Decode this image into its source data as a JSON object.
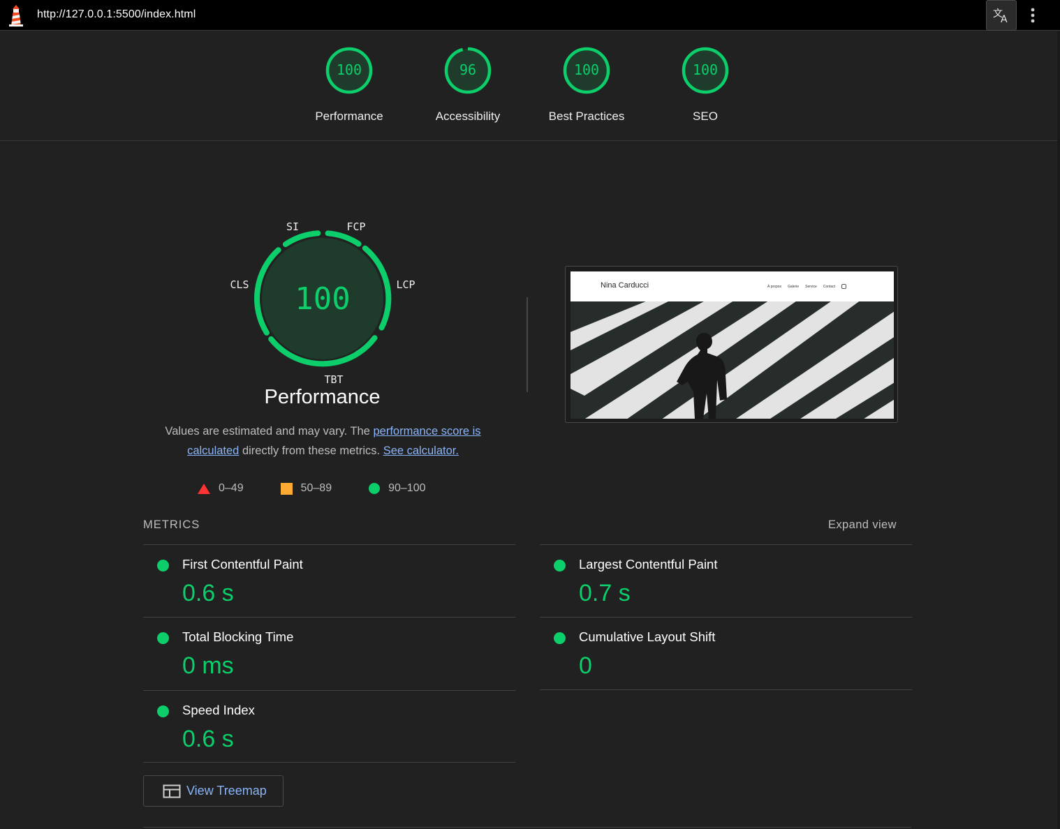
{
  "topbar": {
    "url": "http://127.0.0.1:5500/index.html"
  },
  "colors": {
    "pass": "#0cce6b",
    "average": "#ffaa33",
    "fail": "#ff3333",
    "link": "#8ab4f8"
  },
  "categories": [
    {
      "label": "Performance",
      "score": "100",
      "fraction": 1.0
    },
    {
      "label": "Accessibility",
      "score": "96",
      "fraction": 0.96
    },
    {
      "label": "Best Practices",
      "score": "100",
      "fraction": 1.0
    },
    {
      "label": "SEO",
      "score": "100",
      "fraction": 1.0
    }
  ],
  "performance": {
    "score": "100",
    "title": "Performance",
    "segment_labels": {
      "si": "SI",
      "fcp": "FCP",
      "cls": "CLS",
      "lcp": "LCP",
      "tbt": "TBT"
    }
  },
  "description": {
    "text1": "Values are estimated and may vary. The ",
    "link1": "performance score is calculated",
    "text2": " directly from these metrics. ",
    "link2": "See calculator."
  },
  "legend": {
    "fail": "0–49",
    "average": "50–89",
    "pass": "90–100"
  },
  "screenshot": {
    "site_name": "Nina Carducci",
    "nav": [
      "À propos",
      "Galerie",
      "Service",
      "Contact"
    ]
  },
  "metrics": {
    "title": "METRICS",
    "expand_label": "Expand view",
    "items": [
      {
        "name": "First Contentful Paint",
        "value": "0.6 s"
      },
      {
        "name": "Largest Contentful Paint",
        "value": "0.7 s"
      },
      {
        "name": "Total Blocking Time",
        "value": "0 ms"
      },
      {
        "name": "Cumulative Layout Shift",
        "value": "0"
      },
      {
        "name": "Speed Index",
        "value": "0.6 s"
      }
    ]
  },
  "treemap": {
    "label": "View Treemap"
  }
}
